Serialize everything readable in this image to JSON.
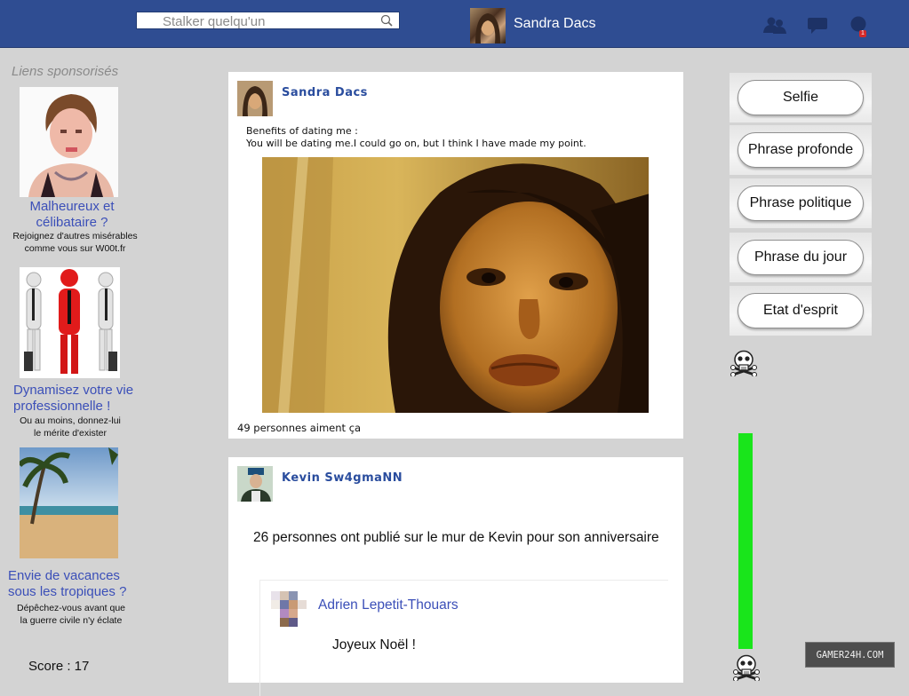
{
  "topbar": {
    "search_placeholder": "Stalker quelqu'un",
    "profile_name": "Sandra Dacs",
    "notification_count": "1",
    "icons": [
      "friends-icon",
      "messages-icon",
      "notifications-icon",
      "search-icon"
    ]
  },
  "sidebar": {
    "title": "Liens sponsorisés",
    "ads": [
      {
        "title_l1": "Malheureux et",
        "title_l2": "célibataire ?",
        "sub_l1": "Rejoignez d'autres misérables",
        "sub_l2": "comme vous sur W00t.fr"
      },
      {
        "title_l1": "Dynamisez votre vie",
        "title_l2": "professionnelle !",
        "sub_l1": "Ou au moins, donnez-lui",
        "sub_l2": "le mérite d'exister"
      },
      {
        "title_l1": "Envie de vacances",
        "title_l2": "sous les tropiques ?",
        "sub_l1": "Dépêchez-vous avant que",
        "sub_l2": "la guerre civile n'y éclate"
      }
    ],
    "score_label": "Score : 17"
  },
  "feed": {
    "posts": [
      {
        "author": "Sandra Dacs",
        "text_l1": "Benefits of dating me :",
        "text_l2": "You will be dating me.I could go on, but I think I have made my point.",
        "likes": "49 personnes aiment ça"
      },
      {
        "author": "Kevin Sw4gmaNN",
        "text": "26 personnes ont publié sur le mur de Kevin pour son anniversaire",
        "comment": {
          "author": "Adrien Lepetit-Thouars",
          "text": "Joyeux Noël !"
        }
      }
    ]
  },
  "choices": [
    "Selfie",
    "Phrase profonde",
    "Phrase politique",
    "Phrase du jour",
    "Etat d'esprit"
  ],
  "meter": {
    "level": 1.0,
    "color": "#19e51b"
  },
  "watermark": "GAMER24H.COM",
  "colors": {
    "topbar": "#2f4d92",
    "link": "#3b4fb8",
    "background": "#d3d3d3"
  }
}
